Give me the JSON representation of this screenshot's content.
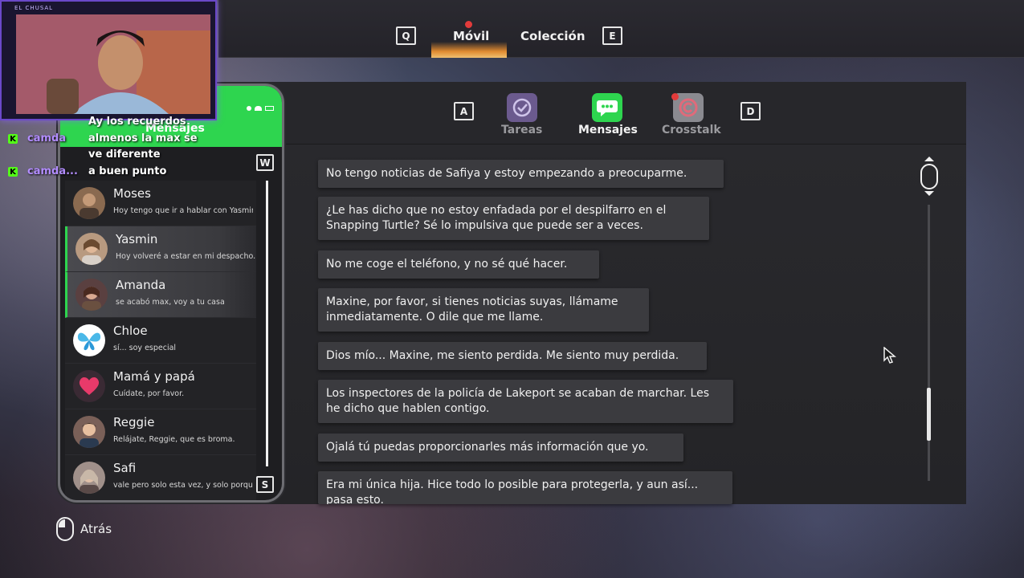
{
  "top_nav": {
    "key_left": "Q",
    "key_right": "E",
    "tabs": [
      {
        "label": "Móvil",
        "active": true
      },
      {
        "label": "Colección",
        "active": false
      }
    ]
  },
  "apps": {
    "key_left": "A",
    "key_right": "D",
    "items": [
      {
        "label": "Tareas",
        "icon": "tasks-icon",
        "active": false
      },
      {
        "label": "Mensajes",
        "icon": "messages-icon",
        "active": true
      },
      {
        "label": "Crosstalk",
        "icon": "crosstalk-icon",
        "active": false
      }
    ]
  },
  "phone": {
    "title": "Mensajes",
    "key_up": "W",
    "key_down": "S",
    "contacts": [
      {
        "name": "Moses",
        "preview": "Hoy tengo que ir a hablar con Yasmin"
      },
      {
        "name": "Yasmin",
        "preview": "Hoy volveré a estar en mi despacho. I"
      },
      {
        "name": "Amanda",
        "preview": "se acabó max, voy a tu casa"
      },
      {
        "name": "Chloe",
        "preview": "sí... soy especial"
      },
      {
        "name": "Mamá y papá",
        "preview": "Cuídate, por favor."
      },
      {
        "name": "Reggie",
        "preview": "Relájate, Reggie, que es broma."
      },
      {
        "name": "Safi",
        "preview": "vale pero solo esta vez, y solo porque"
      }
    ]
  },
  "messages": [
    "No tengo noticias de Safiya y estoy empezando a preocuparme.",
    "¿Le has dicho que no estoy enfadada por el despilfarro en el Snapping Turtle? Sé lo impulsiva que puede ser a veces.",
    "No me coge el teléfono, y no sé qué hacer.",
    "Maxine, por favor, si tienes noticias suyas, llámame inmediatamente. O dile que me llame.",
    "Dios mío... Maxine, me siento perdida. Me siento muy perdida.",
    "Los inspectores de la policía de Lakeport se acaban de marchar. Les he dicho que hablen contigo.",
    "Ojalá tú puedas proporcionarles más información que yo.",
    "Era mi única hija. Hice todo lo posible para protegerla, y aun así... pasa esto."
  ],
  "back": {
    "label": "Atrás"
  },
  "stream": {
    "cam_label": "EL CHUSAL",
    "chat": [
      {
        "user": "",
        "text": "Ay los recuerdos"
      },
      {
        "user": "camda",
        "text": "almenos la max se"
      },
      {
        "user": "",
        "text": "ve diferente"
      },
      {
        "user": "camda...",
        "text": "a buen punto"
      }
    ]
  },
  "colors": {
    "accent_green": "#2ed54f",
    "notification_red": "#e23b3b"
  }
}
